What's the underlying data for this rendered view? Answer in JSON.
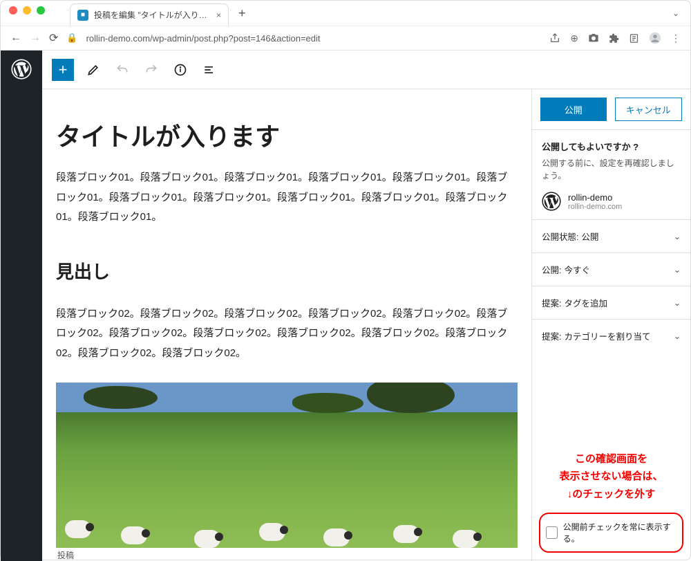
{
  "browser": {
    "tab_title": "投稿を編集 \"タイトルが入ります\"",
    "url": "rollin-demo.com/wp-admin/post.php?post=146&action=edit"
  },
  "editor": {
    "title": "タイトルが入ります",
    "para1": "段落ブロック01。段落ブロック01。段落ブロック01。段落ブロック01。段落ブロック01。段落ブロック01。段落ブロック01。段落ブロック01。段落ブロック01。段落ブロック01。段落ブロック01。段落ブロック01。",
    "heading": "見出し",
    "para2": "段落ブロック02。段落ブロック02。段落ブロック02。段落ブロック02。段落ブロック02。段落ブロック02。段落ブロック02。段落ブロック02。段落ブロック02。段落ブロック02。段落ブロック02。段落ブロック02。段落ブロック02。",
    "footer_label": "投稿"
  },
  "panel": {
    "publish_btn": "公開",
    "cancel_btn": "キャンセル",
    "question": "公開してもよいですか ?",
    "hint": "公開する前に、設定を再確認しましょう。",
    "site_name": "rollin-demo",
    "site_url": "rollin-demo.com",
    "rows": [
      {
        "k": "公開状態:",
        "v": "公開"
      },
      {
        "k": "公開:",
        "v": "今すぐ"
      },
      {
        "k": "提案:",
        "v": "タグを追加"
      },
      {
        "k": "提案:",
        "v": "カテゴリーを割り当て"
      }
    ],
    "checkbox_label": "公開前チェックを常に表示する。"
  },
  "annotation": {
    "line1": "この確認画面を",
    "line2": "表示させない場合は、",
    "line3": "↓のチェックを外す"
  }
}
